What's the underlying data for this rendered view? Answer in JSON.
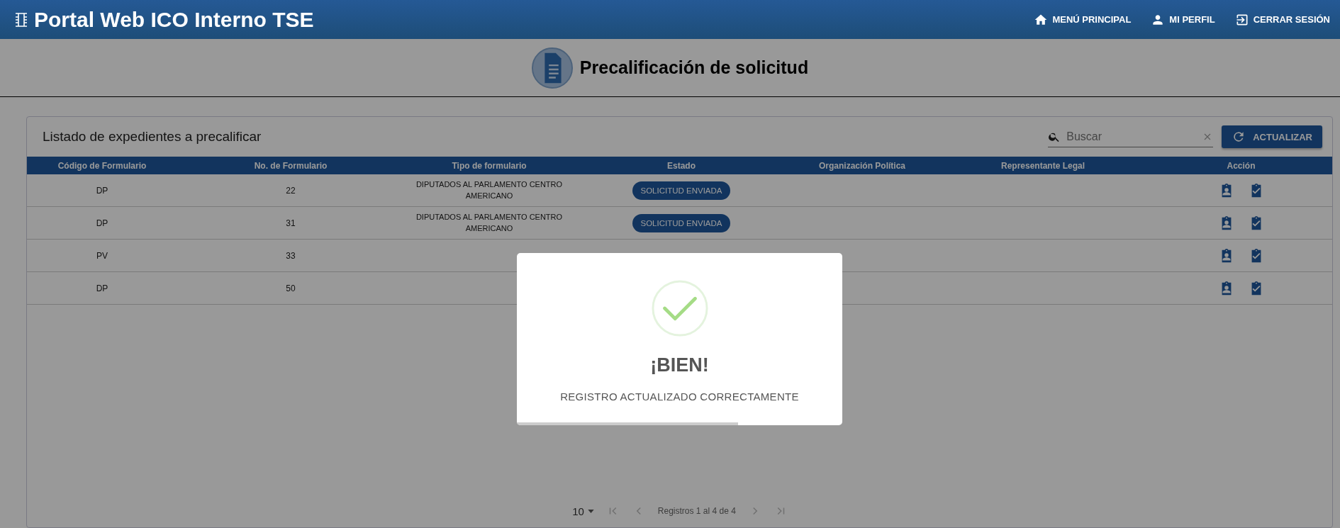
{
  "header": {
    "title": "Portal Web ICO Interno TSE",
    "nav": [
      "MENÚ PRINCIPAL",
      "MI PERFIL",
      "CERRAR SESIÓN"
    ]
  },
  "page_title": "Precalificación de solicitud",
  "card": {
    "title": "Listado de expedientes a precalificar",
    "search": {
      "placeholder": "Buscar"
    },
    "refresh_button": "ACTUALIZAR"
  },
  "table": {
    "columns": [
      "Código de Formulario",
      "No. de Formulario",
      "Tipo de formulario",
      "Estado",
      "Organización Política",
      "Representante Legal",
      "Acción"
    ],
    "rows": [
      {
        "codigo": "DP",
        "numero": "22",
        "tipo": "DIPUTADOS AL PARLAMENTO CENTRO AMERICANO",
        "estado": "SOLICITUD ENVIADA"
      },
      {
        "codigo": "DP",
        "numero": "31",
        "tipo": "DIPUTADOS AL PARLAMENTO CENTRO AMERICANO",
        "estado": "SOLICITUD ENVIADA"
      },
      {
        "codigo": "PV",
        "numero": "33"
      },
      {
        "codigo": "DP",
        "numero": "50"
      }
    ]
  },
  "pagination": {
    "page_size": "10",
    "summary": "Registros 1 al 4 de 4"
  },
  "dialog": {
    "title": "¡BIEN!",
    "message": "REGISTRO ACTUALIZADO CORRECTAMENTE",
    "level": 0.68
  }
}
